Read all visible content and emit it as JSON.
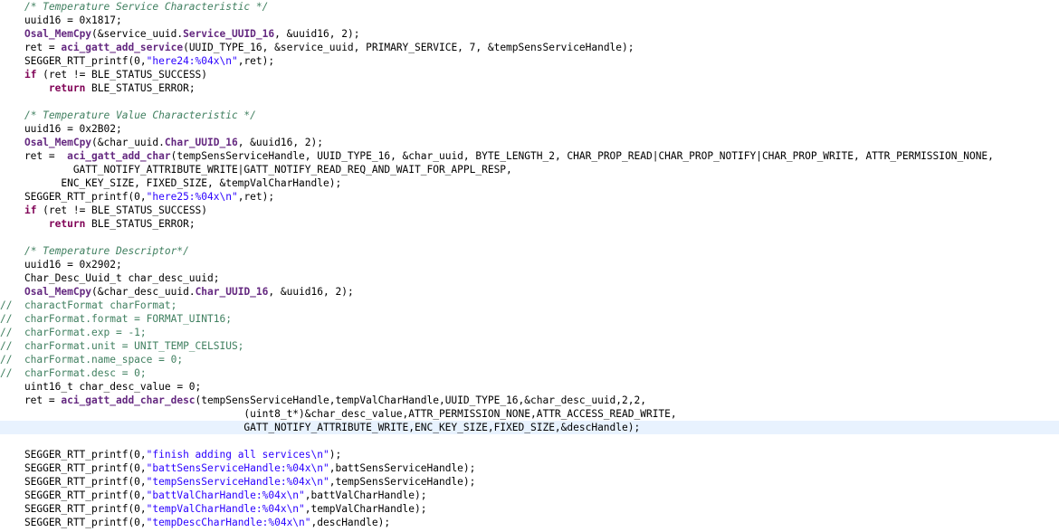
{
  "editor": {
    "current_line_index": 31,
    "lines": [
      [
        {
          "t": "    "
        },
        {
          "t": "/* Temperature Service Characteristic */",
          "c": "cmt"
        }
      ],
      [
        {
          "t": "    uuid16 = 0x1817;"
        }
      ],
      [
        {
          "t": "    "
        },
        {
          "t": "Osal_MemCpy",
          "c": "fn"
        },
        {
          "t": "(&service_uuid."
        },
        {
          "t": "Service_UUID_16",
          "c": "fn"
        },
        {
          "t": ", &uuid16, 2);"
        }
      ],
      [
        {
          "t": "    ret = "
        },
        {
          "t": "aci_gatt_add_service",
          "c": "fn"
        },
        {
          "t": "(UUID_TYPE_16, &service_uuid, PRIMARY_SERVICE, 7, &tempSensServiceHandle);"
        }
      ],
      [
        {
          "t": "    SEGGER_RTT_printf(0,"
        },
        {
          "t": "\"here24:%04x\\n\"",
          "c": "str"
        },
        {
          "t": ",ret);"
        }
      ],
      [
        {
          "t": "    "
        },
        {
          "t": "if",
          "c": "kw"
        },
        {
          "t": " (ret != BLE_STATUS_SUCCESS)"
        }
      ],
      [
        {
          "t": "        "
        },
        {
          "t": "return",
          "c": "kw"
        },
        {
          "t": " BLE_STATUS_ERROR;"
        }
      ],
      [
        {
          "t": ""
        }
      ],
      [
        {
          "t": "    "
        },
        {
          "t": "/* Temperature Value Characteristic */",
          "c": "cmt"
        }
      ],
      [
        {
          "t": "    uuid16 = 0x2B02;"
        }
      ],
      [
        {
          "t": "    "
        },
        {
          "t": "Osal_MemCpy",
          "c": "fn"
        },
        {
          "t": "(&char_uuid."
        },
        {
          "t": "Char_UUID_16",
          "c": "fn"
        },
        {
          "t": ", &uuid16, 2);"
        }
      ],
      [
        {
          "t": "    ret =  "
        },
        {
          "t": "aci_gatt_add_char",
          "c": "fn"
        },
        {
          "t": "(tempSensServiceHandle, UUID_TYPE_16, &char_uuid, BYTE_LENGTH_2, CHAR_PROP_READ|CHAR_PROP_NOTIFY|CHAR_PROP_WRITE, ATTR_PERMISSION_NONE,"
        }
      ],
      [
        {
          "t": "            GATT_NOTIFY_ATTRIBUTE_WRITE|GATT_NOTIFY_READ_REQ_AND_WAIT_FOR_APPL_RESP,"
        }
      ],
      [
        {
          "t": "          ENC_KEY_SIZE, FIXED_SIZE, &tempValCharHandle);"
        }
      ],
      [
        {
          "t": "    SEGGER_RTT_printf(0,"
        },
        {
          "t": "\"here25:%04x\\n\"",
          "c": "str"
        },
        {
          "t": ",ret);"
        }
      ],
      [
        {
          "t": "    "
        },
        {
          "t": "if",
          "c": "kw"
        },
        {
          "t": " (ret != BLE_STATUS_SUCCESS)"
        }
      ],
      [
        {
          "t": "        "
        },
        {
          "t": "return",
          "c": "kw"
        },
        {
          "t": " BLE_STATUS_ERROR;"
        }
      ],
      [
        {
          "t": ""
        }
      ],
      [
        {
          "t": "    "
        },
        {
          "t": "/* Temperature Descriptor*/",
          "c": "cmt"
        }
      ],
      [
        {
          "t": "    uuid16 = 0x2902;"
        }
      ],
      [
        {
          "t": "    Char_Desc_Uuid_t char_desc_uuid;"
        }
      ],
      [
        {
          "t": "    "
        },
        {
          "t": "Osal_MemCpy",
          "c": "fn"
        },
        {
          "t": "(&char_desc_uuid."
        },
        {
          "t": "Char_UUID_16",
          "c": "fn"
        },
        {
          "t": ", &uuid16, 2);"
        }
      ],
      [
        {
          "t": "//  charactFormat charFormat;",
          "c": "lc"
        }
      ],
      [
        {
          "t": "//  charFormat.format = FORMAT_UINT16;",
          "c": "lc"
        }
      ],
      [
        {
          "t": "//  charFormat.exp = -1;",
          "c": "lc"
        }
      ],
      [
        {
          "t": "//  charFormat.unit = UNIT_TEMP_CELSIUS;",
          "c": "lc"
        }
      ],
      [
        {
          "t": "//  charFormat.name_space = 0;",
          "c": "lc"
        }
      ],
      [
        {
          "t": "//  charFormat.desc = 0;",
          "c": "lc"
        }
      ],
      [
        {
          "t": "    uint16_t char_desc_value = 0;"
        }
      ],
      [
        {
          "t": "    ret = "
        },
        {
          "t": "aci_gatt_add_char_desc",
          "c": "fn"
        },
        {
          "t": "(tempSensServiceHandle,tempValCharHandle,UUID_TYPE_16,&char_desc_uuid,2,2,"
        }
      ],
      [
        {
          "t": "                                        (uint8_t*)&char_desc_value,ATTR_PERMISSION_NONE,ATTR_ACCESS_READ_WRITE,"
        }
      ],
      [
        {
          "t": "                                        GATT_NOTIFY_ATTRIBUTE_WRITE,ENC_KEY_SIZE,FIXED_SIZE,&descHandle);"
        }
      ],
      [
        {
          "t": ""
        }
      ],
      [
        {
          "t": "    SEGGER_RTT_printf(0,"
        },
        {
          "t": "\"finish adding all services\\n\"",
          "c": "str"
        },
        {
          "t": ");"
        }
      ],
      [
        {
          "t": "    SEGGER_RTT_printf(0,"
        },
        {
          "t": "\"battSensServiceHandle:%04x\\n\"",
          "c": "str"
        },
        {
          "t": ",battSensServiceHandle);"
        }
      ],
      [
        {
          "t": "    SEGGER_RTT_printf(0,"
        },
        {
          "t": "\"tempSensServiceHandle:%04x\\n\"",
          "c": "str"
        },
        {
          "t": ",tempSensServiceHandle);"
        }
      ],
      [
        {
          "t": "    SEGGER_RTT_printf(0,"
        },
        {
          "t": "\"battValCharHandle:%04x\\n\"",
          "c": "str"
        },
        {
          "t": ",battValCharHandle);"
        }
      ],
      [
        {
          "t": "    SEGGER_RTT_printf(0,"
        },
        {
          "t": "\"tempValCharHandle:%04x\\n\"",
          "c": "str"
        },
        {
          "t": ",tempValCharHandle);"
        }
      ],
      [
        {
          "t": "    SEGGER_RTT_printf(0,"
        },
        {
          "t": "\"tempDescCharHandle:%04x\\n\"",
          "c": "str"
        },
        {
          "t": ",descHandle);"
        }
      ]
    ]
  }
}
